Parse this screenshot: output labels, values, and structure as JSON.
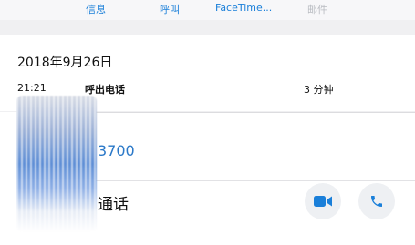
{
  "actions": {
    "message": "信息",
    "call": "呼叫",
    "facetime": "FaceTime...",
    "mail": "邮件"
  },
  "call_log": {
    "date": "2018年9月26日",
    "time": "21:21",
    "type": "呼出电话",
    "duration": "3 分钟"
  },
  "contact": {
    "phone_number_visible": "3700",
    "call_label": "通话",
    "accent_color": "#1a7fd9"
  },
  "icons": [
    "video-camera-icon",
    "phone-handset-icon"
  ]
}
